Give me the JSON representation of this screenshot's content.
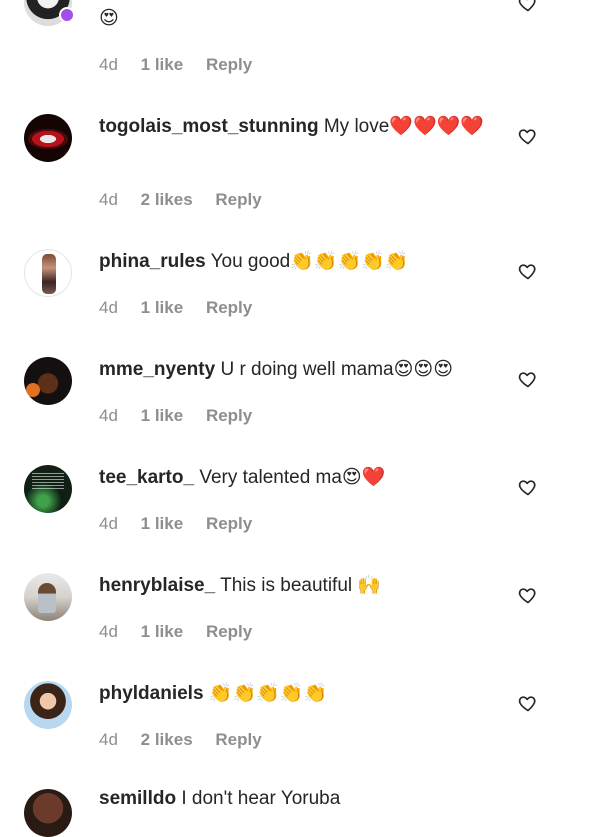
{
  "comments": [
    {
      "username": "",
      "text": "😍",
      "time": "4d",
      "likes": "1 like",
      "reply": "Reply"
    },
    {
      "username": "togolais_most_stunning",
      "text": "My love❤️❤️❤️❤️",
      "time": "4d",
      "likes": "2 likes",
      "reply": "Reply"
    },
    {
      "username": "phina_rules",
      "text": "You good👏👏👏👏👏",
      "time": "4d",
      "likes": "1 like",
      "reply": "Reply"
    },
    {
      "username": "mme_nyenty",
      "text": "U r doing well mama😍😍😍",
      "time": "4d",
      "likes": "1 like",
      "reply": "Reply"
    },
    {
      "username": "tee_karto_",
      "text": "Very talented ma😍❤️",
      "time": "4d",
      "likes": "1 like",
      "reply": "Reply"
    },
    {
      "username": "henryblaise_",
      "text": "This is beautiful 🙌",
      "time": "4d",
      "likes": "1 like",
      "reply": "Reply"
    },
    {
      "username": "phyldaniels",
      "text": "👏👏👏👏👏",
      "time": "4d",
      "likes": "2 likes",
      "reply": "Reply"
    },
    {
      "username": "semilldo",
      "text": "I don't hear Yoruba"
    }
  ],
  "icons": {
    "like": "heart-outline-icon",
    "story_ring": "purple-story-badge"
  },
  "colors": {
    "text": "#262626",
    "meta": "#8e8e8e",
    "heart_emoji": "#d7141a",
    "badge": "#a24ee8"
  }
}
